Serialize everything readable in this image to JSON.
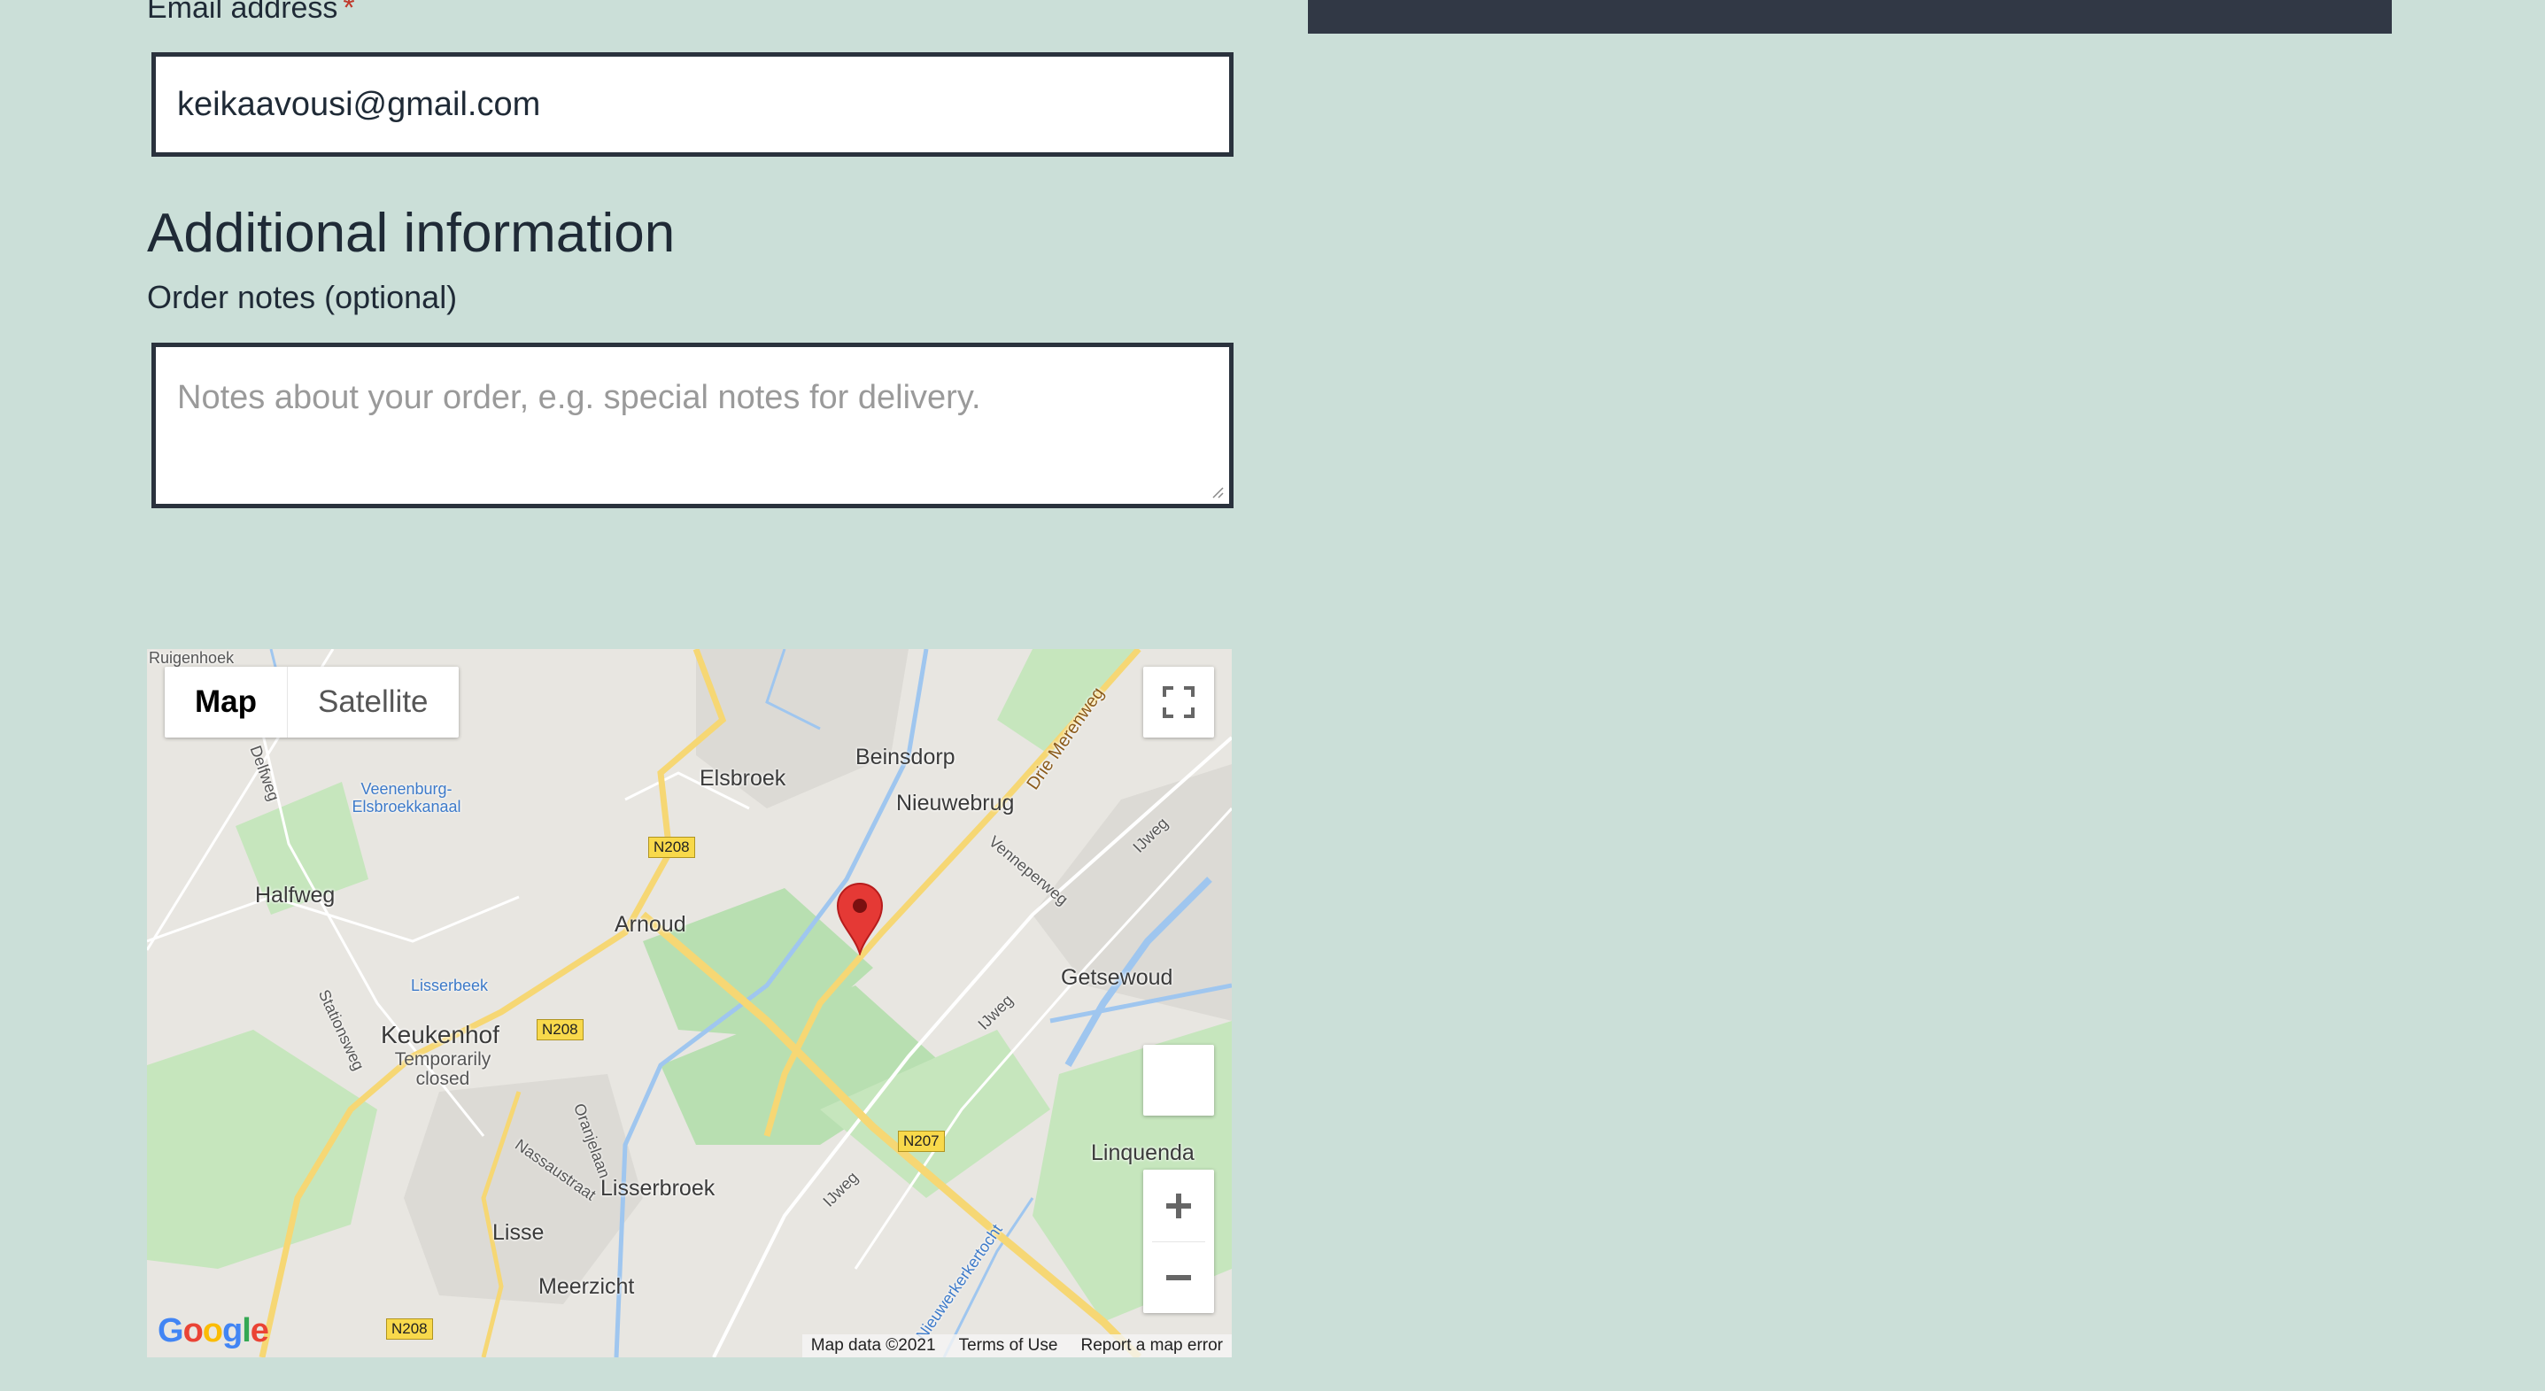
{
  "form": {
    "email_label": "Email address",
    "required_mark": "*",
    "email_value": "keikaavousi@gmail.com",
    "section_heading": "Additional information",
    "notes_label": "Order notes (optional)",
    "notes_placeholder": "Notes about your order, e.g. special notes for delivery."
  },
  "map": {
    "type_buttons": [
      "Map",
      "Satellite"
    ],
    "active_type": "Map",
    "places": {
      "ruigenhoek": "Ruigenhoek",
      "beinsdorp": "Beinsdorp",
      "elsbroek": "Elsbroek",
      "nieuwebrug": "Nieuwebrug",
      "halfweg": "Halfweg",
      "arnoud": "Arnoud",
      "getsewoud": "Getsewoud",
      "keukenhof": "Keukenhof",
      "keukenhof_status": "Temporarily closed",
      "linquenda": "Linquenda",
      "lisserbroek": "Lisserbroek",
      "lisse": "Lisse",
      "meerzicht": "Meerzicht"
    },
    "streets": {
      "drie_merenweg": "Drie Merenweg",
      "venneperweg": "Venneperweg",
      "ijweg_1": "IJweg",
      "ijweg_2": "IJweg",
      "ijweg_3": "IJweg",
      "delfweg": "Delfweg",
      "stationsweg": "Stationsweg",
      "oranjelaan": "Oranjelaan",
      "nassaustraat": "Nassaustraat",
      "nieuwerkerkertocht": "Nieuwerkerkertocht"
    },
    "water": {
      "kanaal": "Veenenburg-Elsbroekkanaal",
      "lisserbeek": "Lisserbeek"
    },
    "shields": {
      "n208_top": "N208",
      "n208_mid": "N208",
      "n208_bottom": "N208",
      "n207": "N207"
    },
    "attribution": {
      "map_data": "Map data ©2021",
      "terms": "Terms of Use",
      "report": "Report a map error"
    },
    "logo_text": "Google",
    "colors": {
      "land": "#e8e6e1",
      "green": "#b8dfb1",
      "road": "#f6d774",
      "water": "#9fc6ef",
      "marker": "#e53935"
    }
  }
}
